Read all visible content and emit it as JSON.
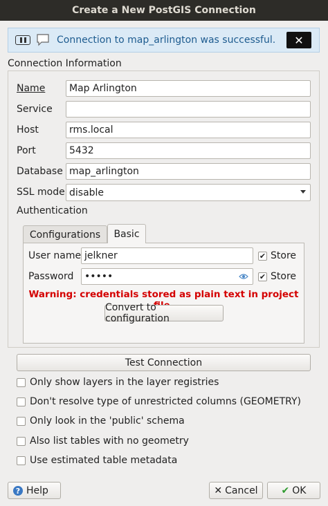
{
  "window": {
    "title": "Create a New PostGIS Connection"
  },
  "banner": {
    "message": "Connection to map_arlington was successful.",
    "close_label": "✕"
  },
  "connection_info": {
    "heading": "Connection Information",
    "fields": {
      "name": {
        "label": "Name",
        "value": "Map Arlington"
      },
      "service": {
        "label": "Service",
        "value": ""
      },
      "host": {
        "label": "Host",
        "value": "rms.local"
      },
      "port": {
        "label": "Port",
        "value": "5432"
      },
      "database": {
        "label": "Database",
        "value": "map_arlington"
      },
      "ssl_mode": {
        "label": "SSL mode",
        "value": "disable"
      }
    }
  },
  "authentication": {
    "heading": "Authentication",
    "tabs": [
      "Configurations",
      "Basic"
    ],
    "active_tab": "Basic",
    "username": {
      "label": "User name",
      "value": "jelkner",
      "store_label": "Store",
      "store_checked": true
    },
    "password": {
      "label": "Password",
      "value": "•••••",
      "store_label": "Store",
      "store_checked": true
    },
    "warning": "Warning: credentials stored as plain text in project file.",
    "convert_button": "Convert to configuration"
  },
  "test_button": "Test Connection",
  "options": [
    {
      "label": "Only show layers in the layer registries",
      "checked": false
    },
    {
      "label": "Don't resolve type of unrestricted columns (GEOMETRY)",
      "checked": false
    },
    {
      "label": "Only look in the 'public' schema",
      "checked": false
    },
    {
      "label": "Also list tables with no geometry",
      "checked": false
    },
    {
      "label": "Use estimated table metadata",
      "checked": false
    }
  ],
  "footer": {
    "help": "Help",
    "cancel": "Cancel",
    "ok": "OK"
  },
  "colors": {
    "titlebar": "#2d2c28",
    "banner_bg": "#dbeaf6",
    "banner_text": "#1d5b8f",
    "warning": "#d40000",
    "ok_check": "#2e9a2e"
  }
}
